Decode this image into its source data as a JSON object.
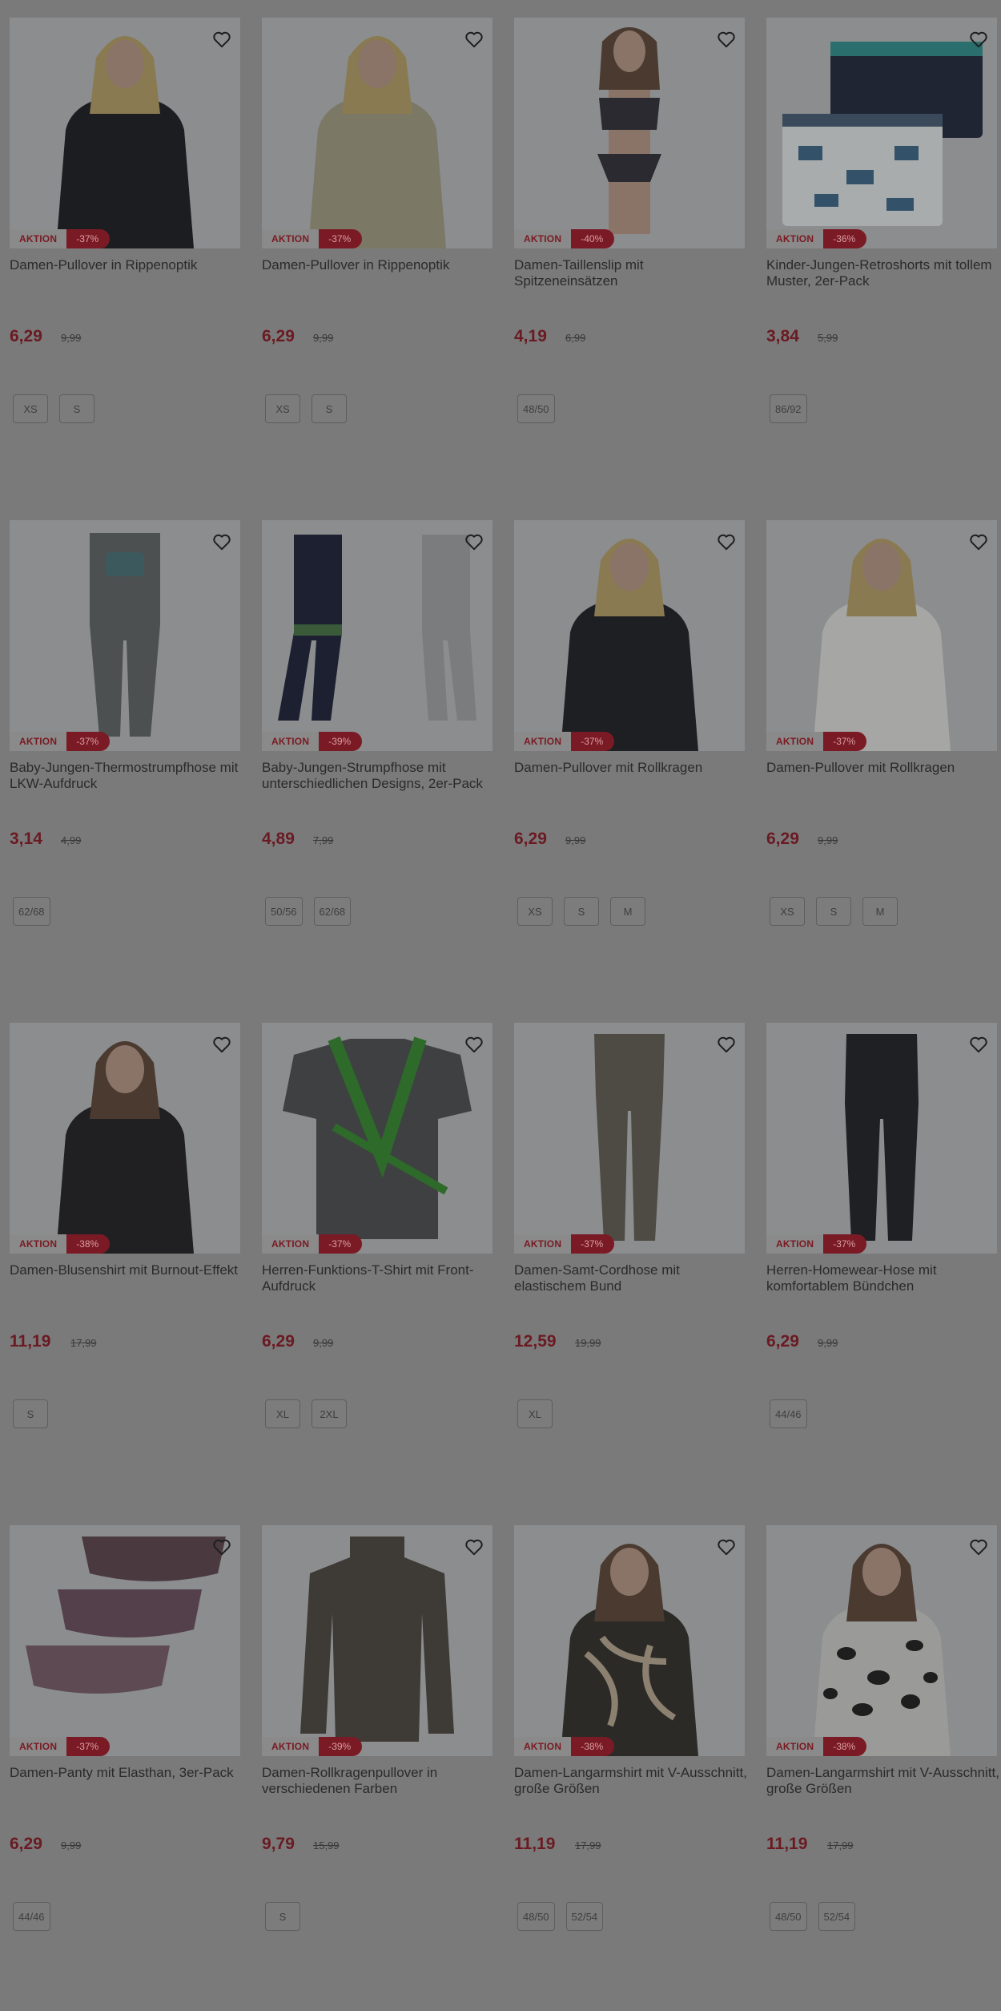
{
  "labels": {
    "promo": "AKTION"
  },
  "colors": {
    "overlay": "#7a7a7a",
    "price": "#6a1a22",
    "discount_badge": "#7a1a24"
  },
  "products": [
    {
      "title": "Damen-Pullover in Rippenoptik",
      "price": "6,29",
      "old_price": "9,99",
      "discount": "-37%",
      "sizes": [
        "XS",
        "S"
      ],
      "image": "woman-black-turtleneck"
    },
    {
      "title": "Damen-Pullover in Rippenoptik",
      "price": "6,29",
      "old_price": "9,99",
      "discount": "-37%",
      "sizes": [
        "XS",
        "S"
      ],
      "image": "woman-beige-turtleneck"
    },
    {
      "title": "Damen-Taillenslip mit Spitzeneinsätzen",
      "price": "4,19",
      "old_price": "6,99",
      "discount": "-40%",
      "sizes": [
        "48/50"
      ],
      "image": "lingerie-model"
    },
    {
      "title": "Kinder-Jungen-Retroshorts mit tollem Muster, 2er-Pack",
      "price": "3,84",
      "old_price": "5,99",
      "discount": "-36%",
      "sizes": [
        "86/92"
      ],
      "image": "kids-shorts"
    },
    {
      "title": "Baby-Jungen-Thermostrumpfhose mit LKW-Aufdruck",
      "price": "3,14",
      "old_price": "4,99",
      "discount": "-37%",
      "sizes": [
        "62/68"
      ],
      "image": "grey-tights"
    },
    {
      "title": "Baby-Jungen-Strumpfhose mit unterschiedlichen Designs, 2er-Pack",
      "price": "4,89",
      "old_price": "7,99",
      "discount": "-39%",
      "sizes": [
        "50/56",
        "62/68"
      ],
      "image": "tights-two-pack"
    },
    {
      "title": "Damen-Pullover mit Rollkragen",
      "price": "6,29",
      "old_price": "9,99",
      "discount": "-37%",
      "sizes": [
        "XS",
        "S",
        "M"
      ],
      "image": "woman-black-rollneck"
    },
    {
      "title": "Damen-Pullover mit Rollkragen",
      "price": "6,29",
      "old_price": "9,99",
      "discount": "-37%",
      "sizes": [
        "XS",
        "S",
        "M"
      ],
      "image": "woman-white-rollneck"
    },
    {
      "title": "Damen-Blusenshirt mit Burnout-Effekt",
      "price": "11,19",
      "old_price": "17,99",
      "discount": "-38%",
      "sizes": [
        "S"
      ],
      "image": "woman-black-blouse"
    },
    {
      "title": "Herren-Funktions-T-Shirt mit Front-Aufdruck",
      "price": "6,29",
      "old_price": "9,99",
      "discount": "-37%",
      "sizes": [
        "XL",
        "2XL"
      ],
      "image": "grey-tshirt-green-print"
    },
    {
      "title": "Damen-Samt-Cordhose mit elastischem Bund",
      "price": "12,59",
      "old_price": "19,99",
      "discount": "-37%",
      "sizes": [
        "XL"
      ],
      "image": "brown-cord-pants"
    },
    {
      "title": "Herren-Homewear-Hose mit komfortablem Bündchen",
      "price": "6,29",
      "old_price": "9,99",
      "discount": "-37%",
      "sizes": [
        "44/46"
      ],
      "image": "black-jogger-pants"
    },
    {
      "title": "Damen-Panty mit Elasthan, 3er-Pack",
      "price": "6,29",
      "old_price": "9,99",
      "discount": "-37%",
      "sizes": [
        "44/46"
      ],
      "image": "panty-three-pack"
    },
    {
      "title": "Damen-Rollkragenpullover in verschiedenen Farben",
      "price": "9,79",
      "old_price": "15,99",
      "discount": "-39%",
      "sizes": [
        "S"
      ],
      "image": "brown-turtleneck"
    },
    {
      "title": "Damen-Langarmshirt mit V-Ausschnitt, große Größen",
      "price": "11,19",
      "old_price": "17,99",
      "discount": "-38%",
      "sizes": [
        "48/50",
        "52/54"
      ],
      "image": "woman-pattern-shirt"
    },
    {
      "title": "Damen-Langarmshirt mit V-Ausschnitt, große Größen",
      "price": "11,19",
      "old_price": "17,99",
      "discount": "-38%",
      "sizes": [
        "48/50",
        "52/54"
      ],
      "image": "woman-leopard-shirt"
    }
  ]
}
